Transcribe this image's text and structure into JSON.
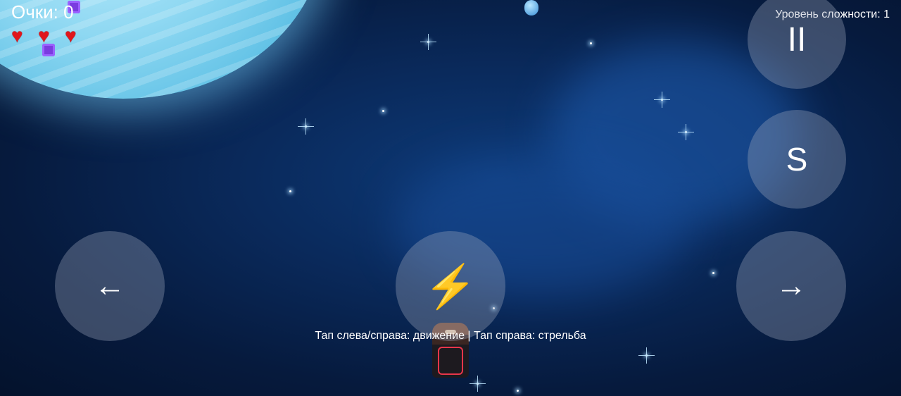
{
  "hud": {
    "score_label": "Очки: 0",
    "level_label": "Уровень сложности: 1",
    "lives": 3,
    "heart_icon": "heart-icon"
  },
  "controls": {
    "left_label": "←",
    "fire_label": "⚡",
    "right_label": "→",
    "pause_label": "II",
    "special_label": "S"
  },
  "help_text": "Тап слева/справа: движение | Тап справа: стрельба",
  "colors": {
    "heart": "#e0161c",
    "fire": "#f5c400",
    "button": "rgba(160,170,190,.35)"
  }
}
